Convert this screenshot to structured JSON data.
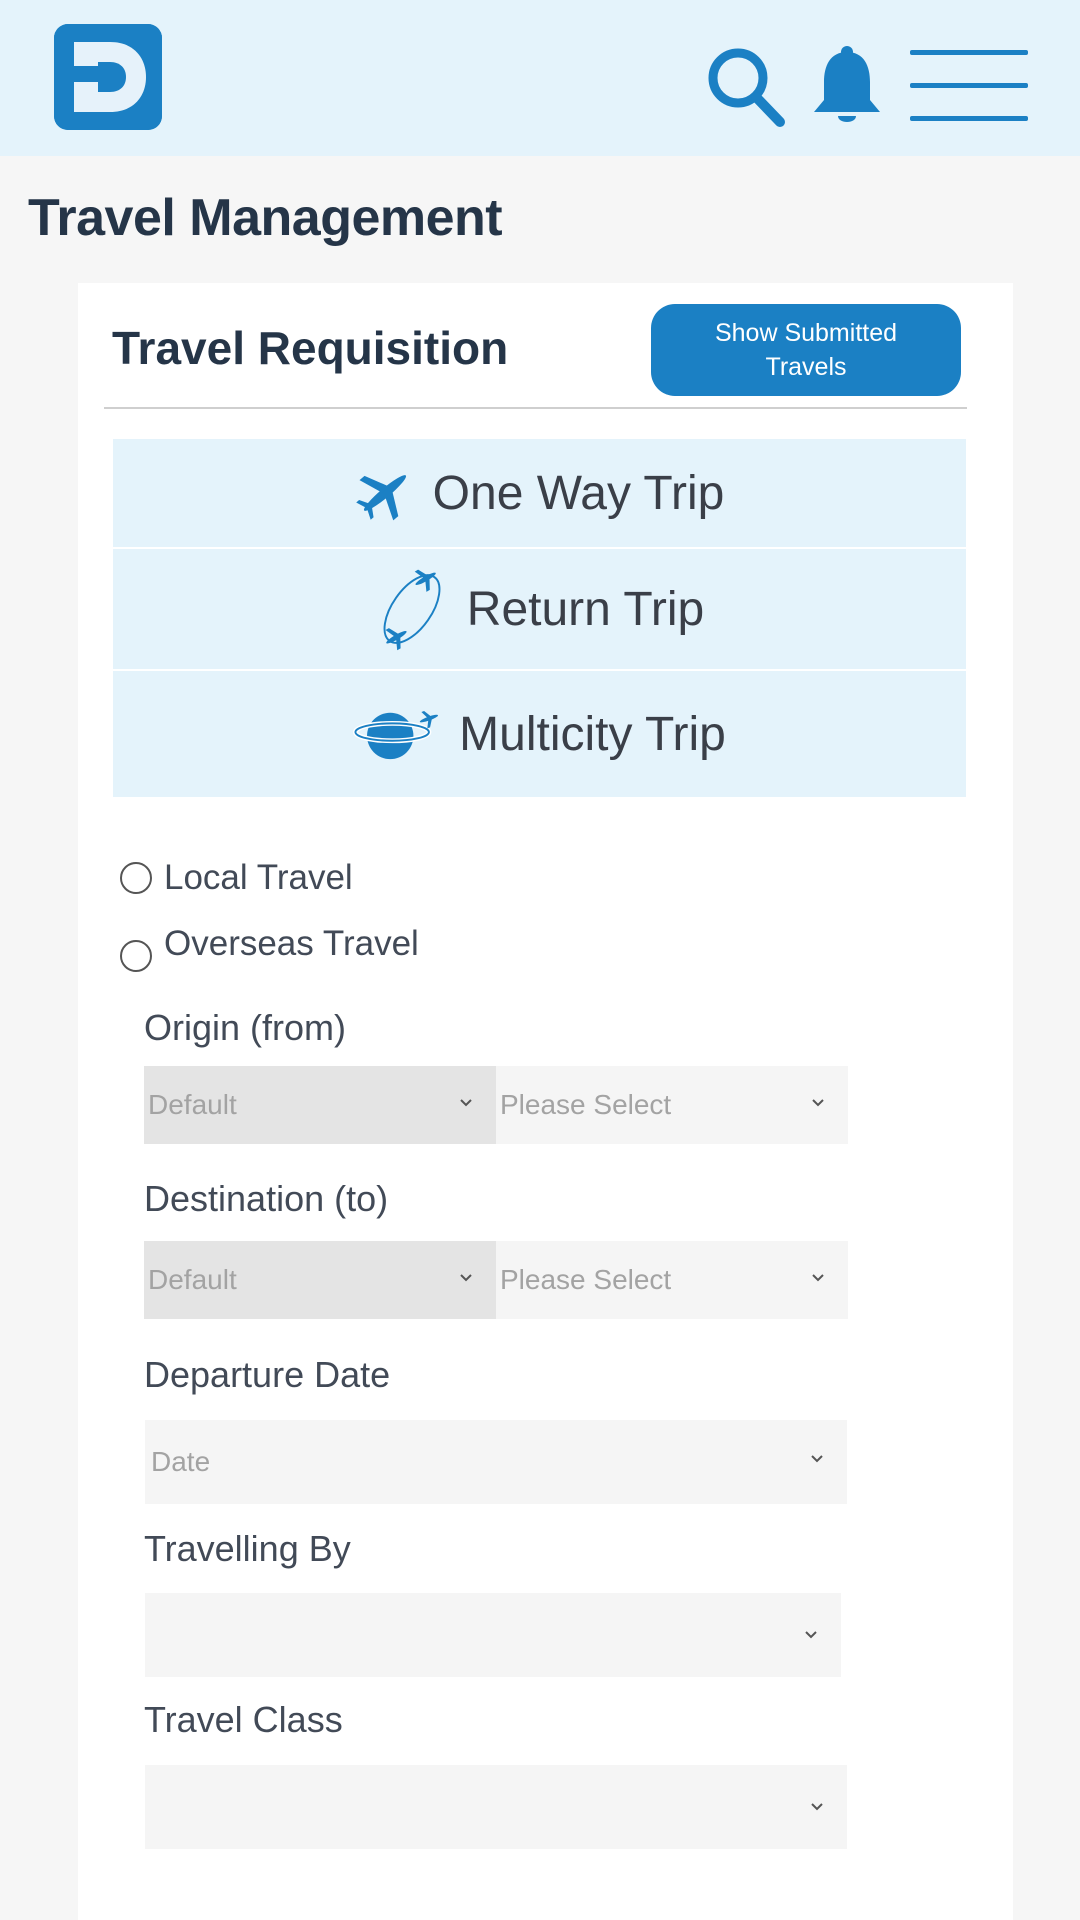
{
  "header": {
    "logo_letter": "D",
    "icons": [
      "search-icon",
      "bell-icon",
      "menu-icon"
    ]
  },
  "page": {
    "title": "Travel Management"
  },
  "card": {
    "title": "Travel Requisition",
    "show_submitted_label": "Show Submitted Travels"
  },
  "trip_types": [
    {
      "label": "One Way Trip",
      "icon": "plane-icon"
    },
    {
      "label": "Return Trip",
      "icon": "return-flight-icon"
    },
    {
      "label": "Multicity Trip",
      "icon": "globe-plane-icon"
    }
  ],
  "travel_scope": [
    {
      "label": "Local Travel",
      "checked": false
    },
    {
      "label": "Overseas Travel",
      "checked": false
    }
  ],
  "form": {
    "origin": {
      "label": "Origin (from)",
      "country_value": "Default",
      "city_placeholder": "Please Select"
    },
    "destination": {
      "label": "Destination (to)",
      "country_value": "Default",
      "city_placeholder": "Please Select"
    },
    "departure_date": {
      "label": "Departure Date",
      "placeholder": "Date"
    },
    "travelling_by": {
      "label": "Travelling By",
      "value": ""
    },
    "travel_class": {
      "label": "Travel Class",
      "value": ""
    }
  },
  "colors": {
    "brand": "#1b80c4",
    "header_bg": "#e4f3fb",
    "title": "#253548"
  }
}
